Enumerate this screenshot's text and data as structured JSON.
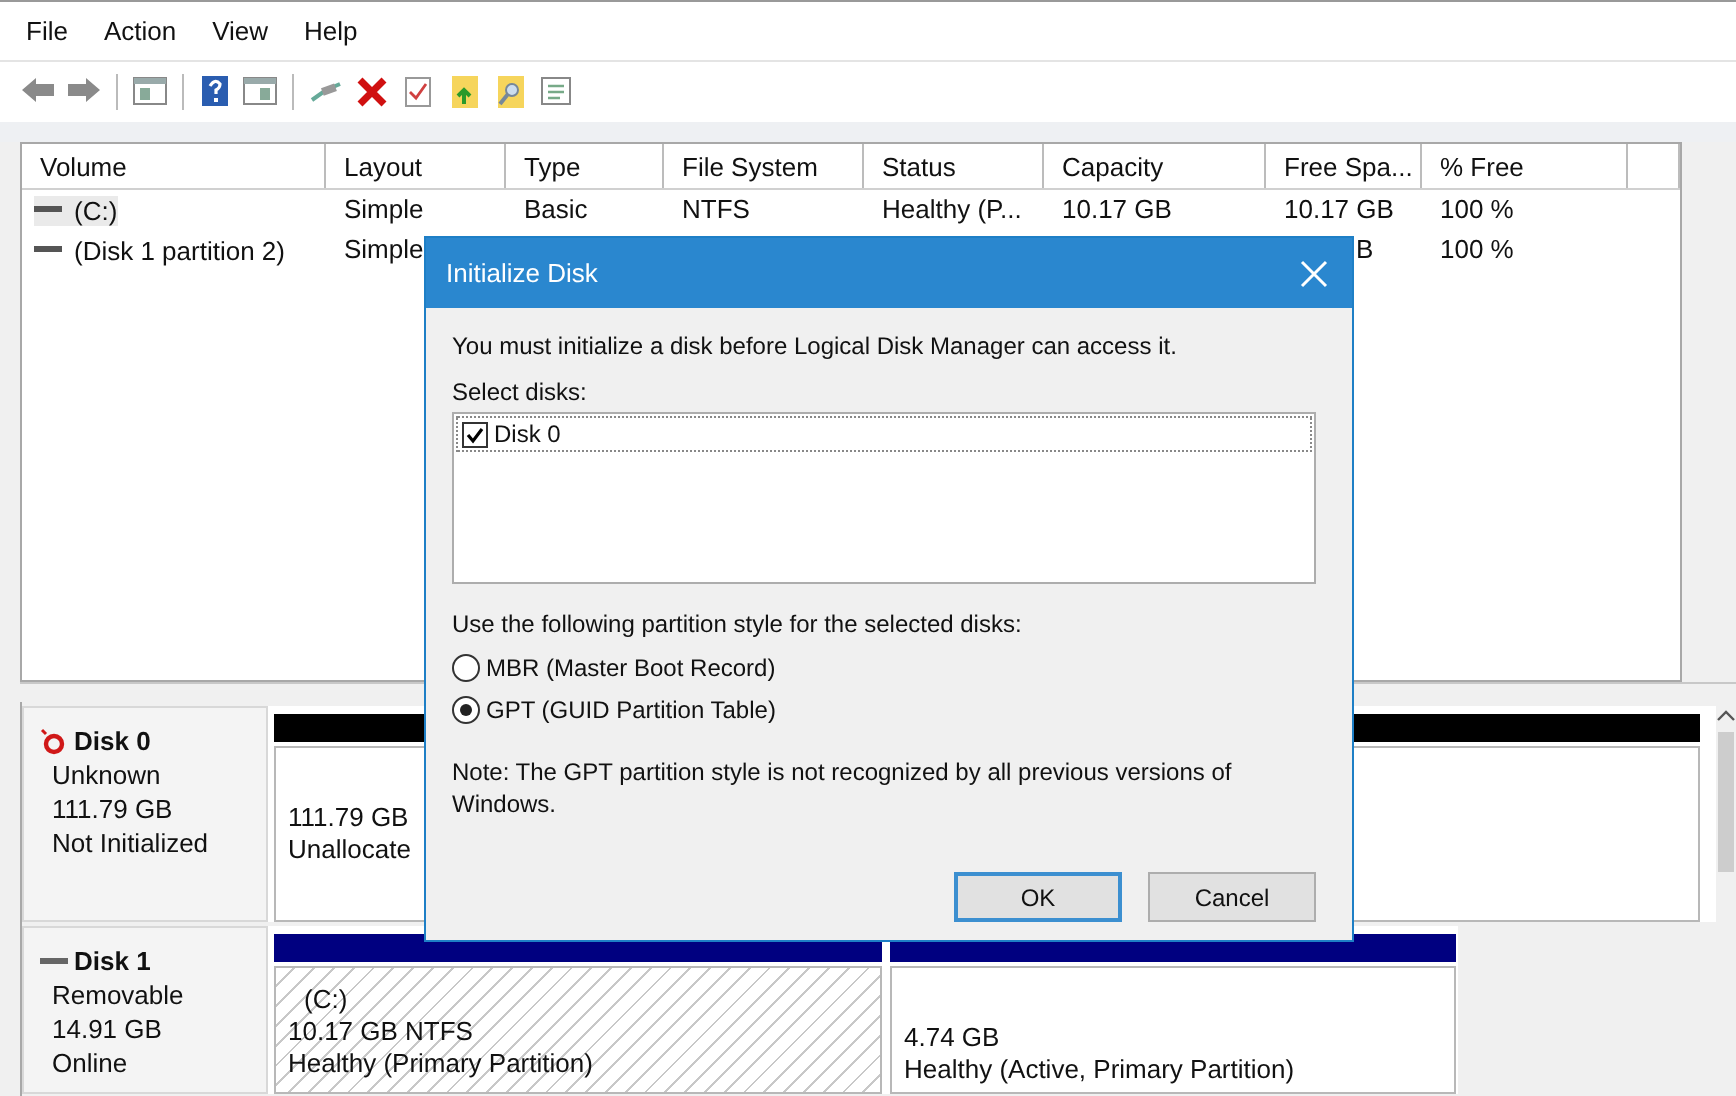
{
  "menu": [
    "File",
    "Action",
    "View",
    "Help"
  ],
  "table": {
    "columns": [
      "Volume",
      "Layout",
      "Type",
      "File System",
      "Status",
      "Capacity",
      "Free Spa...",
      "% Free"
    ],
    "rows": [
      {
        "volume": "(C:)",
        "layout": "Simple",
        "type": "Basic",
        "file_system": "NTFS",
        "status": "Healthy (P...",
        "capacity": "10.17 GB",
        "free_space": "10.17 GB",
        "percent_free": "100 %"
      },
      {
        "volume": "(Disk 1 partition 2)",
        "layout": "Simple",
        "free_space": "B",
        "percent_free": "100 %"
      }
    ]
  },
  "disks": [
    {
      "name": "Disk 0",
      "kind": "not_initialized",
      "lines": [
        "Unknown",
        "111.79 GB",
        "Not Initialized"
      ],
      "partitions": [
        {
          "lines": [
            "111.79 GB",
            "Unallocate"
          ],
          "color": "#000000",
          "selected": false
        }
      ]
    },
    {
      "name": "Disk 1",
      "kind": "online",
      "lines": [
        "Removable",
        "14.91 GB",
        "Online"
      ],
      "partitions": [
        {
          "lines": [
            "(C:)",
            "10.17 GB NTFS",
            "Healthy (Primary Partition)"
          ],
          "color": "#000080",
          "selected": true
        },
        {
          "lines": [
            "4.74 GB",
            "Healthy (Active, Primary Partition)"
          ],
          "color": "#000080",
          "selected": false
        }
      ]
    }
  ],
  "dialog": {
    "title": "Initialize Disk",
    "message": "You must initialize a disk before Logical Disk Manager can access it.",
    "select_label": "Select disks:",
    "disks": [
      {
        "label": "Disk 0",
        "checked": true
      }
    ],
    "style_label": "Use the following partition style for the selected disks:",
    "styles": [
      {
        "label": "MBR (Master Boot Record)",
        "selected": false
      },
      {
        "label": "GPT (GUID Partition Table)",
        "selected": true
      }
    ],
    "note": "Note: The GPT partition style is not recognized by all previous versions of Windows.",
    "buttons": [
      {
        "label": "OK",
        "default": true
      },
      {
        "label": "Cancel",
        "default": false
      }
    ]
  }
}
